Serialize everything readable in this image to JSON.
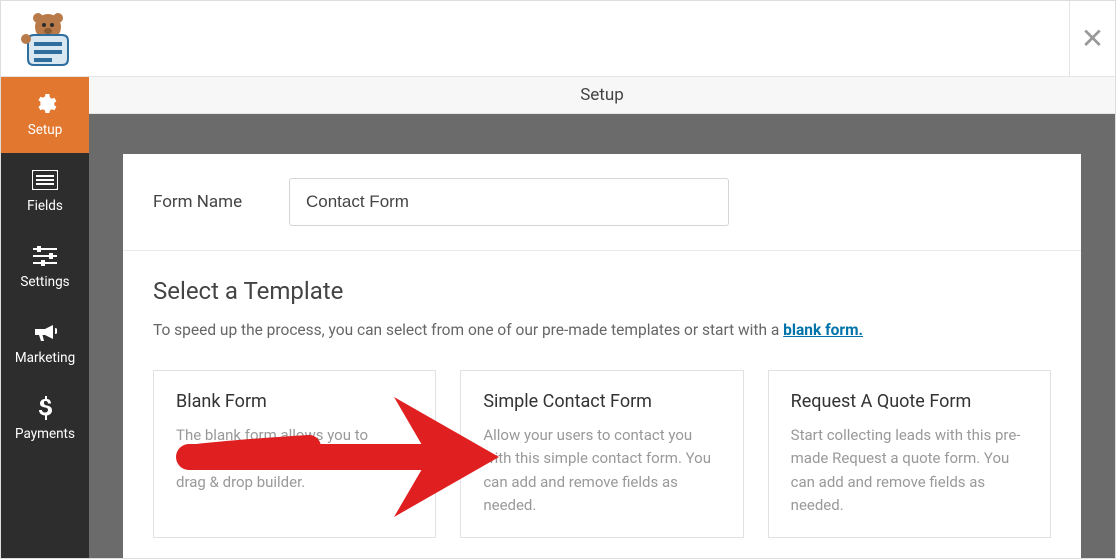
{
  "header": {
    "page_title": "Setup"
  },
  "sidebar": {
    "items": [
      {
        "label": "Setup",
        "icon": "gear"
      },
      {
        "label": "Fields",
        "icon": "list"
      },
      {
        "label": "Settings",
        "icon": "sliders"
      },
      {
        "label": "Marketing",
        "icon": "bullhorn"
      },
      {
        "label": "Payments",
        "icon": "dollar"
      }
    ]
  },
  "form_name": {
    "label": "Form Name",
    "value": "Contact Form"
  },
  "template_section": {
    "heading": "Select a Template",
    "subtext_prefix": "To speed up the process, you can select from one of our pre-made templates or start with a ",
    "blank_link": "blank form."
  },
  "templates": [
    {
      "title": "Blank Form",
      "description": "The blank form allows you to create any type of form using our drag & drop builder."
    },
    {
      "title": "Simple Contact Form",
      "description": "Allow your users to contact you with this simple contact form. You can add and remove fields as needed."
    },
    {
      "title": "Request A Quote Form",
      "description": "Start collecting leads with this pre-made Request a quote form. You can add and remove fields as needed."
    }
  ]
}
